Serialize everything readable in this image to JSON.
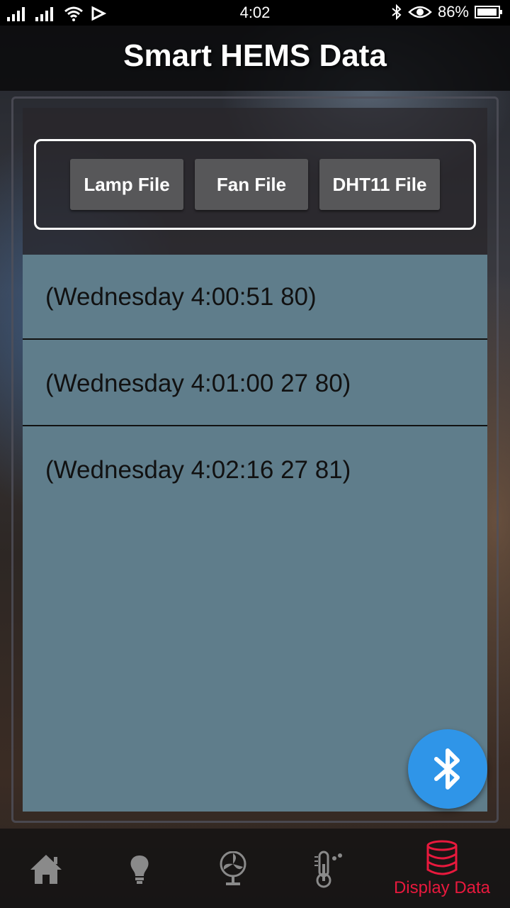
{
  "status_bar": {
    "time": "4:02",
    "battery_percent": "86%",
    "icons": [
      "signal-icon",
      "signal-icon",
      "wifi-icon",
      "cast-icon",
      "bluetooth-icon",
      "eye-icon",
      "battery-icon"
    ]
  },
  "app_bar": {
    "title": "Smart HEMS Data"
  },
  "file_buttons": [
    {
      "label": "Lamp File"
    },
    {
      "label": "Fan File"
    },
    {
      "label": "DHT11 File"
    }
  ],
  "records": [
    "(Wednesday 4:00:51 80)",
    "(Wednesday 4:01:00 27 80)",
    "(Wednesday 4:02:16 27 81)"
  ],
  "fab": {
    "icon": "bluetooth-icon"
  },
  "bottom_nav": {
    "items": [
      {
        "icon": "home-icon",
        "label": ""
      },
      {
        "icon": "lightbulb-icon",
        "label": ""
      },
      {
        "icon": "fan-icon",
        "label": ""
      },
      {
        "icon": "thermometer-icon",
        "label": ""
      },
      {
        "icon": "database-icon",
        "label": "Display Data",
        "active": true
      }
    ],
    "active_color": "#e8193d",
    "inactive_color": "#8a8a8a"
  },
  "colors": {
    "list_background": "#5f7d8b",
    "fab": "#2f95e8",
    "button": "#575759"
  }
}
